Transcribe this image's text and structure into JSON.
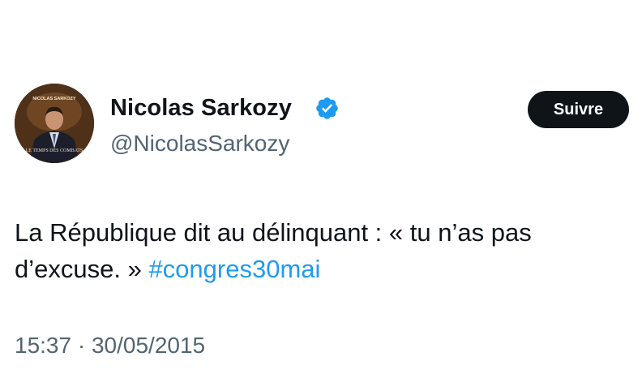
{
  "author": {
    "name": "Nicolas Sarkozy",
    "handle": "@NicolasSarkozy",
    "verified_icon": "verified-badge-icon",
    "avatar": {
      "top_text": "NICOLAS SARKOZY",
      "bottom_text": "LE TEMPS DES COMBATS",
      "background_color": "#3a2616"
    }
  },
  "follow_button": {
    "label": "Suivre"
  },
  "tweet": {
    "text_before_hashtag": "La République dit au délinquant : «  tu n’as pas d’excuse. » ",
    "hashtag": "#congres30mai"
  },
  "meta": {
    "time": "15:37",
    "separator": " · ",
    "date": "30/05/2015"
  },
  "colors": {
    "text": "#0f1419",
    "secondary": "#536471",
    "link": "#1d9bf0",
    "verified": "#1d9bf0",
    "button": "#0f1419"
  }
}
